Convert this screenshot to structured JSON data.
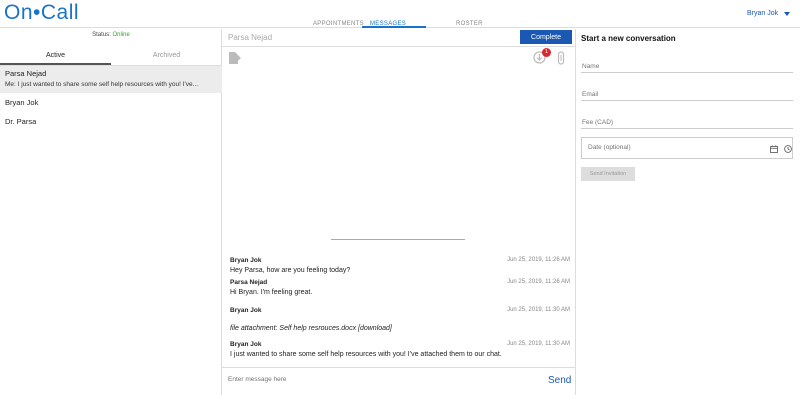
{
  "app": {
    "logo": "On•Call"
  },
  "nav": {
    "appointments": "APPOINTMENTS",
    "messages": "MESSAGES",
    "roster": "ROSTER",
    "user": "Bryan Jok"
  },
  "sidebar": {
    "status_label": "Status:",
    "status_value": "Online",
    "tabs": [
      "Active",
      "Archived"
    ],
    "conversations": [
      {
        "name": "Parsa Nejad",
        "preview": "Me: I just wanted to share some self help resources with you! I've..."
      },
      {
        "name": "Bryan Jok"
      },
      {
        "name": "Dr. Parsa"
      }
    ]
  },
  "chat": {
    "header_name": "Parsa Nejad",
    "complete_label": "Complete",
    "badge_count": "1",
    "messages": [
      {
        "sender": "Bryan Jok",
        "time": "Jun 25, 2019, 11:26 AM",
        "body": "Hey Parsa, how are you feeling today?"
      },
      {
        "sender": "Parsa Nejad",
        "time": "Jun 25, 2019, 11:26 AM",
        "body": "Hi Bryan. I'm feeling great."
      },
      {
        "sender": "Bryan Jok",
        "time": "Jun 25, 2019, 11:30 AM",
        "body": ""
      },
      {
        "sender": "Bryan Jok",
        "time": "Jun 25, 2019, 11:30 AM",
        "body": "I just wanted to share some self help resources with you! I've attached them to our chat."
      }
    ],
    "attachment_text": "file attachment: Self help resrouces.docx [download]",
    "composer_placeholder": "Enter message here",
    "send_label": "Send"
  },
  "new_conversation": {
    "title": "Start a new conversation",
    "name_placeholder": "Name",
    "email_placeholder": "Email",
    "fee_placeholder": "Fee (CAD)",
    "date_placeholder": "Date (optional)",
    "send_invite_label": "Send Invitation"
  },
  "colors": {
    "brand": "#1a73c9",
    "accent": "#1a58b4",
    "online": "#3a9a3a",
    "badge": "#d9282f"
  }
}
